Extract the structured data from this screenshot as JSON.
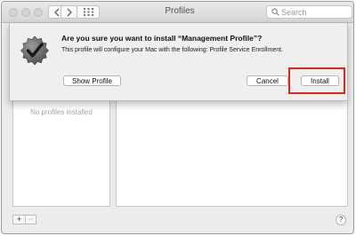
{
  "window": {
    "title": "Profiles",
    "search": {
      "placeholder": "Search",
      "value": ""
    }
  },
  "dialog": {
    "heading": "Are you sure you want to install “Management Profile”?",
    "message": "This profile will configure your Mac with the following: Profile Service Enrollment.",
    "buttons": {
      "show_profile": "Show Profile",
      "cancel": "Cancel",
      "install": "Install"
    },
    "highlight_color": "#e0241a"
  },
  "profiles": {
    "empty_label": "No profiles installed",
    "add_label": "+",
    "remove_label": "−",
    "help_label": "?"
  },
  "icons": [
    "back-icon",
    "forward-icon",
    "grid-icon",
    "search-icon",
    "verified-badge-icon"
  ]
}
